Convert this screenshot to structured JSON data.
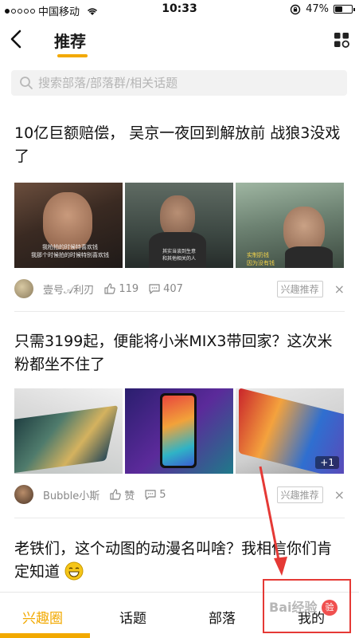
{
  "status_bar": {
    "carrier": "中国移动",
    "time": "10:33",
    "battery": "47%",
    "battery_level": 0.47
  },
  "nav": {
    "title": "推荐"
  },
  "search": {
    "placeholder": "搜索部落/部落群/相关话题"
  },
  "posts": [
    {
      "title": "10亿巨额赔偿，  吴京一夜回到解放前 战狼3没戏了",
      "author": "壹号𝒜利刃",
      "likes": "119",
      "comments": "407",
      "tag": "兴趣推荐",
      "close": "×",
      "image_captions": [
        "我柏拍的时候特喜欢钱\n我那个时候拍的时候特别喜欢钱",
        "其实当谈到生意\n和其他相关的人",
        "实制扔钱\n因为没有钱"
      ]
    },
    {
      "title": "只需3199起，便能将小米MIX3带回家？这次米粉都坐不住了",
      "author": "Bubble小斯",
      "likes": "赞",
      "comments": "5",
      "tag": "兴趣推荐",
      "close": "×",
      "image_badge": "+1"
    },
    {
      "title": "老铁们，这个动图的动漫名叫啥？我相信你们肯定知道"
    }
  ],
  "tabs": [
    {
      "label": "兴趣圈",
      "active": true
    },
    {
      "label": "话题",
      "active": false
    },
    {
      "label": "部落",
      "active": false
    },
    {
      "label": "我的",
      "active": false
    }
  ],
  "badge": {
    "text": "验"
  },
  "watermark": {
    "text": "Bai经验"
  },
  "colors": {
    "accent": "#f2a900",
    "badge_red": "#f0504f",
    "annotation_red": "#e53935"
  },
  "icons": [
    "back-arrow-icon",
    "grid-icon",
    "search-icon",
    "thumbs-up-icon",
    "comment-icon",
    "wifi-icon",
    "lock-rotation-icon"
  ]
}
